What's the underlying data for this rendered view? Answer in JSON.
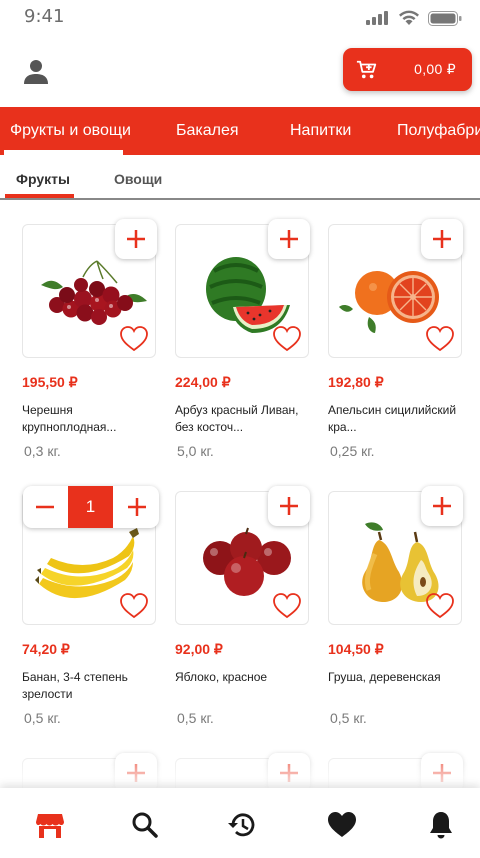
{
  "status_bar": {
    "time": "9:41",
    "icons": [
      "signal-icon",
      "wifi-icon",
      "battery-icon"
    ]
  },
  "header": {
    "profile_icon": "user-icon",
    "cart": {
      "icon": "cart-icon",
      "amount": "0,00 ₽"
    }
  },
  "category_tabs": [
    {
      "label": "Фрукты и овощи",
      "active": true
    },
    {
      "label": "Бакалея",
      "active": false
    },
    {
      "label": "Напитки",
      "active": false
    },
    {
      "label": "Полуфабри",
      "active": false
    }
  ],
  "sub_tabs": [
    {
      "label": "Фрукты",
      "active": true
    },
    {
      "label": "Овощи",
      "active": false
    }
  ],
  "products": [
    {
      "price": "195,50 ₽",
      "name": "Черешня крупноплодная...",
      "weight": "0,3 кг.",
      "image": "cherries",
      "quantity": null
    },
    {
      "price": "224,00 ₽",
      "name": "Арбуз красный Ливан, без косточ...",
      "weight": "5,0 кг.",
      "image": "watermelon",
      "quantity": null
    },
    {
      "price": "192,80 ₽",
      "name": "Апельсин сицилийский кра...",
      "weight": "0,25 кг.",
      "image": "orange",
      "quantity": null
    },
    {
      "price": "74,20 ₽",
      "name": "Банан, 3-4 степень зрелости",
      "weight": "0,5 кг.",
      "image": "banana",
      "quantity": "1"
    },
    {
      "price": "92,00 ₽",
      "name": "Яблоко, красное",
      "weight": "0,5 кг.",
      "image": "apple",
      "quantity": null
    },
    {
      "price": "104,50 ₽",
      "name": "Груша, деревенская",
      "weight": "0,5 кг.",
      "image": "pear",
      "quantity": null
    }
  ],
  "bottom_nav": [
    {
      "icon": "store-icon",
      "active": true
    },
    {
      "icon": "search-icon",
      "active": false
    },
    {
      "icon": "history-icon",
      "active": false
    },
    {
      "icon": "heart-icon",
      "active": false
    },
    {
      "icon": "bell-icon",
      "active": false
    }
  ],
  "colors": {
    "accent": "#e8311c",
    "text": "#222222",
    "muted": "#7a7a7a"
  }
}
